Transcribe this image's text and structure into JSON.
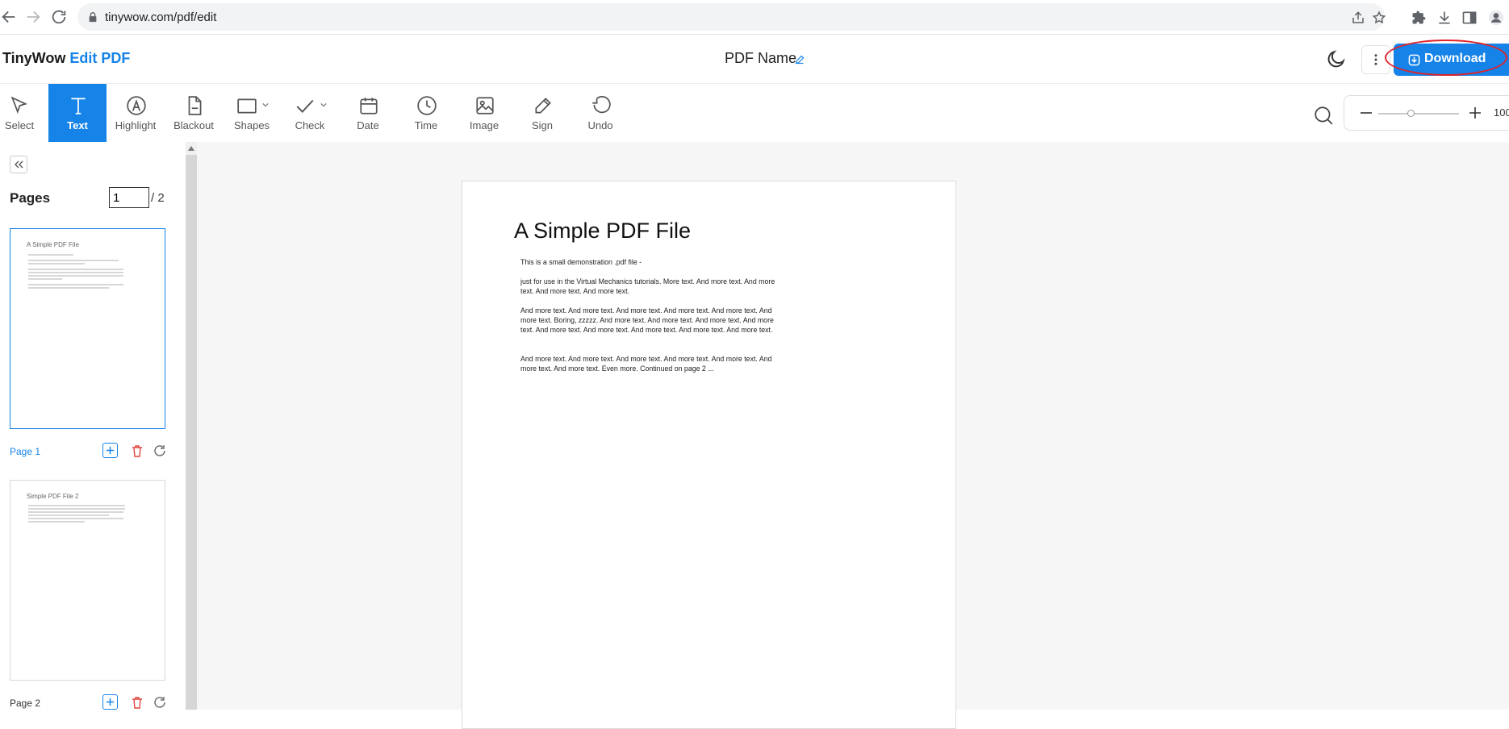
{
  "browser": {
    "url": "tinywow.com/pdf/edit"
  },
  "header": {
    "brand_main": "TinyWow",
    "brand_product": "Edit PDF",
    "doc_name": "PDF Name",
    "download_label": "Download"
  },
  "toolbar": {
    "tools": [
      {
        "label": "Select",
        "icon": "cursor-arrow-icon",
        "active": false
      },
      {
        "label": "Text",
        "icon": "text-t-icon",
        "active": true
      },
      {
        "label": "Highlight",
        "icon": "highlight-icon",
        "active": false
      },
      {
        "label": "Blackout",
        "icon": "blackout-icon",
        "active": false
      },
      {
        "label": "Shapes",
        "icon": "square-shape-icon",
        "active": false
      },
      {
        "label": "Check",
        "icon": "checkmark-icon",
        "active": false
      },
      {
        "label": "Date",
        "icon": "calendar-icon",
        "active": false
      },
      {
        "label": "Time",
        "icon": "clock-icon",
        "active": false
      },
      {
        "label": "Image",
        "icon": "image-icon",
        "active": false
      },
      {
        "label": "Sign",
        "icon": "pen-icon",
        "active": false
      },
      {
        "label": "Undo",
        "icon": "undo-icon",
        "active": false
      }
    ],
    "zoom_value": "100",
    "zoom_level": 0.4
  },
  "sidebar": {
    "title": "Pages",
    "current_page": "1",
    "total_label": "/ 2",
    "pages": [
      {
        "label": "Page 1",
        "thumb_title": "A Simple PDF File",
        "selected": true
      },
      {
        "label": "Page 2",
        "thumb_title": "Simple PDF File 2",
        "selected": false
      }
    ]
  },
  "document": {
    "title": "A Simple PDF File",
    "paragraphs": [
      "This is a small demonstration .pdf file -",
      "just for use in the Virtual Mechanics tutorials. More text. And more text. And more text. And more text. And more text.",
      "And more text. And more text. And more text. And more text. And more text. And more text. Boring, zzzzz. And more text. And more text. And more text. And more text. And more text. And more text. And more text. And more text. And more text.",
      "And more text. And more text. And more text. And more text. And more text. And more text. And more text. Even more. Continued on page 2 ..."
    ]
  },
  "colors": {
    "accent": "#1683e8",
    "annotation": "#e0222a",
    "delete": "#e0443c"
  }
}
